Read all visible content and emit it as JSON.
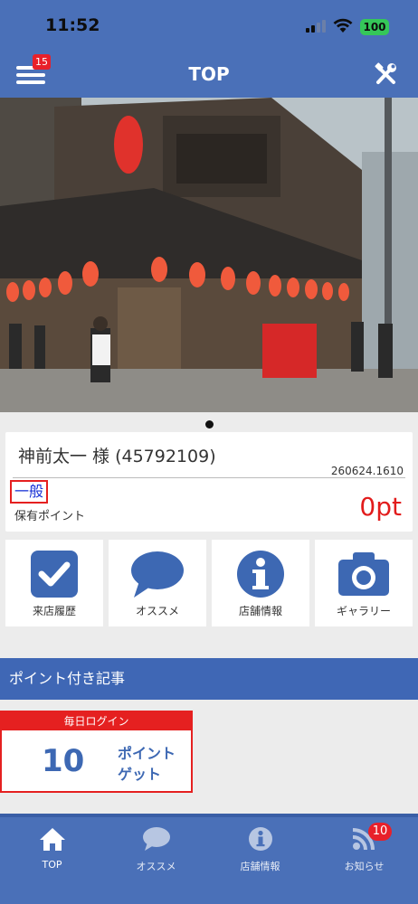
{
  "status_bar": {
    "time": "11:52",
    "battery": "100"
  },
  "header": {
    "title": "TOP",
    "menu_badge": "15"
  },
  "member": {
    "name": "神前太一 様 (45792109)",
    "stamp": "260624.1610",
    "rank": "一般",
    "points_label": "保有ポイント",
    "points_value": "0pt"
  },
  "tiles": [
    {
      "label": "来店履歴",
      "icon": "checkbox-icon"
    },
    {
      "label": "オススメ",
      "icon": "speech-bubble-icon"
    },
    {
      "label": "店舗情報",
      "icon": "info-icon"
    },
    {
      "label": "ギャラリー",
      "icon": "camera-icon"
    }
  ],
  "section": {
    "title": "ポイント付き記事"
  },
  "daily_login": {
    "header": "毎日ログイン",
    "points": "10",
    "unit_line1": "ポイント",
    "unit_line2": "ゲット"
  },
  "tabbar": {
    "items": [
      {
        "label": "TOP",
        "icon": "home-icon",
        "active": true
      },
      {
        "label": "オススメ",
        "icon": "speech-bubble-icon",
        "active": false
      },
      {
        "label": "店舗情報",
        "icon": "info-icon",
        "active": false
      },
      {
        "label": "お知らせ",
        "icon": "rss-icon",
        "active": false,
        "badge": "10"
      }
    ]
  },
  "colors": {
    "brand": "#4a70b8",
    "section": "#3f67b5",
    "accent_red": "#e21c1c",
    "icon_blue": "#3d68b3"
  }
}
